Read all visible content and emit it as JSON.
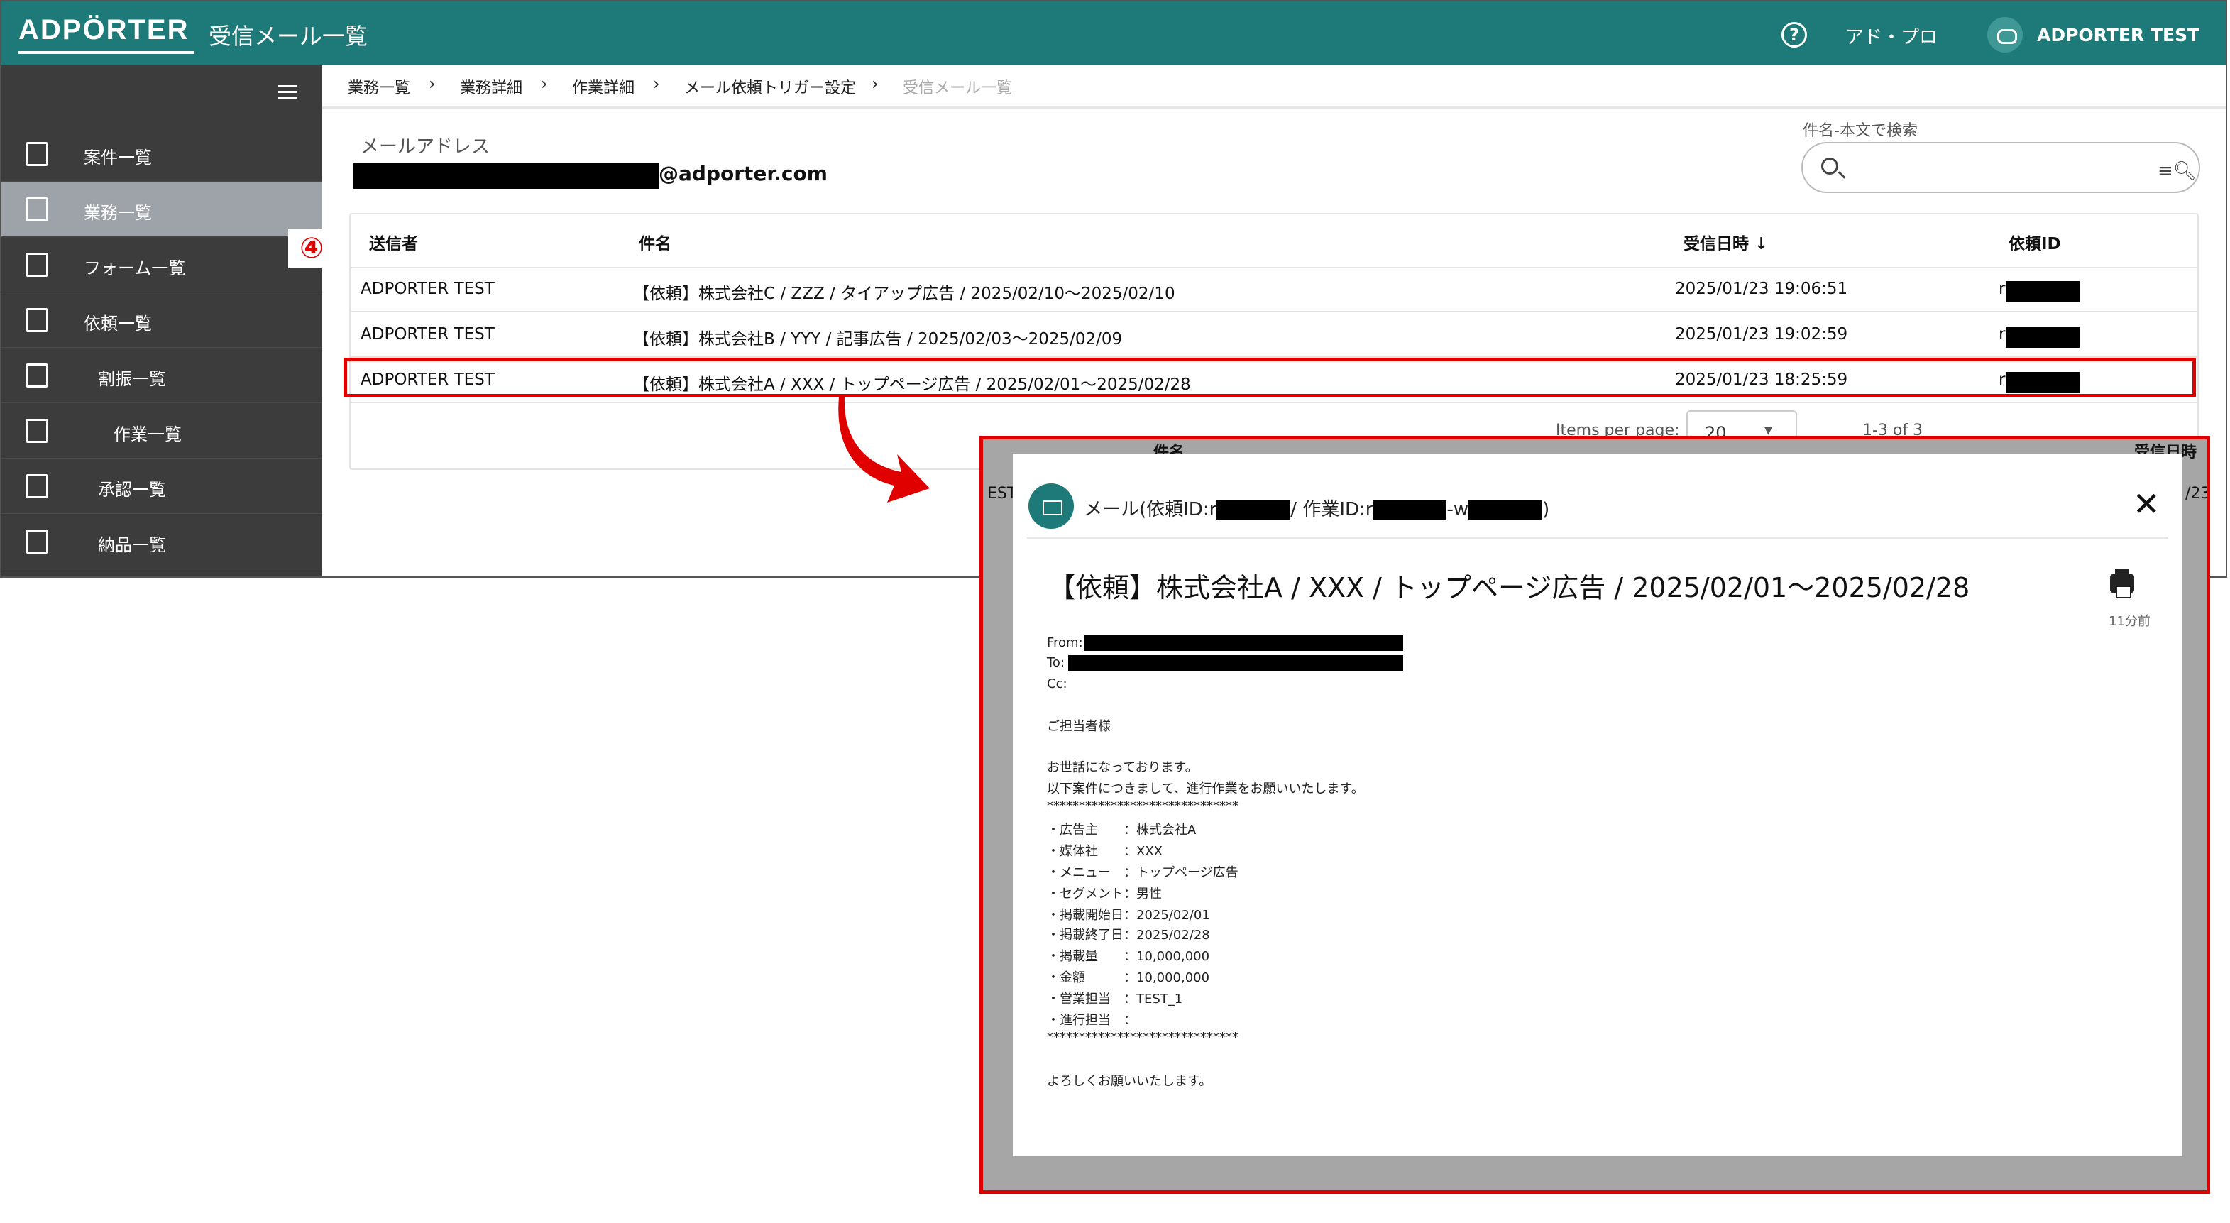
{
  "header": {
    "logo": "ADPÖRTER",
    "title": "受信メール一覧",
    "link": "アド・プロ",
    "user": "ADPORTER TEST"
  },
  "sidebar": {
    "items": [
      {
        "label": "案件一覧"
      },
      {
        "label": "業務一覧"
      },
      {
        "label": "フォーム一覧"
      },
      {
        "label": "依頼一覧"
      },
      {
        "label": "割振一覧"
      },
      {
        "label": "作業一覧"
      },
      {
        "label": "承認一覧"
      },
      {
        "label": "納品一覧"
      }
    ],
    "step_badge": "④"
  },
  "breadcrumb": [
    "業務一覧",
    "業務詳細",
    "作業詳細",
    "メール依頼トリガー設定",
    "受信メール一覧"
  ],
  "mail": {
    "label": "メールアドレス",
    "domain": "@adporter.com"
  },
  "search": {
    "label": "件名-本文で検索",
    "value": ""
  },
  "table": {
    "headers": [
      "送信者",
      "件名",
      "受信日時 ↓",
      "依頼ID"
    ],
    "rows": [
      {
        "sender": "ADPORTER TEST",
        "subject": "【依頼】株式会社C / ZZZ / タイアップ広告 / 2025/02/10〜2025/02/10",
        "received": "2025/01/23 19:06:51",
        "id_prefix": "r"
      },
      {
        "sender": "ADPORTER TEST",
        "subject": "【依頼】株式会社B / YYY / 記事広告 / 2025/02/03〜2025/02/09",
        "received": "2025/01/23 19:02:59",
        "id_prefix": "r"
      },
      {
        "sender": "ADPORTER TEST",
        "subject": "【依頼】株式会社A / XXX / トップページ広告 / 2025/02/01〜2025/02/28",
        "received": "2025/01/23 18:25:59",
        "id_prefix": "r"
      }
    ],
    "pager": {
      "items_per_page_label": "Items per page:",
      "items_per_page": "20",
      "range": "1-3 of 3"
    }
  },
  "dialog": {
    "behind_col1": "件名",
    "behind_col2": "受信日時",
    "behind_left": "EST",
    "behind_right": "/23",
    "title_prefix": "メール(依頼ID:r",
    "title_mid": "/ 作業ID:r",
    "title_mid2": "-w",
    "title_suffix": ")",
    "subject": "【依頼】株式会社A / XXX / トップページ広告 / 2025/02/01〜2025/02/28",
    "time": "11分前",
    "from_label": "From:",
    "to_label": "To:",
    "cc_label": "Cc:",
    "body": [
      "ご担当者様",
      "",
      "お世話になっております。",
      "以下案件につきまして、進行作業をお願いいたします。",
      "******************************",
      "・広告主　　：株式会社A",
      "・媒体社　　：XXX",
      "・メニュー　：トップページ広告",
      "・セグメント：男性",
      "・掲載開始日：2025/02/01",
      "・掲載終了日：2025/02/28",
      "・掲載量　　：10,000,000",
      "・金額　　　：10,000,000",
      "・営業担当　：TEST_1",
      "・進行担当　：",
      "******************************",
      "",
      "よろしくお願いいたします。"
    ]
  }
}
